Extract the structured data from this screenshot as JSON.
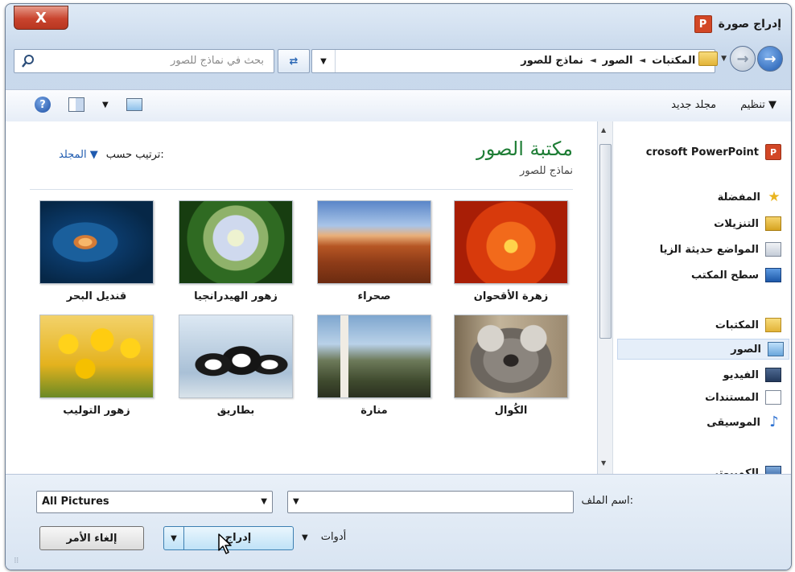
{
  "window": {
    "title": "إدراج صورة",
    "close_label": "X"
  },
  "address": {
    "crumbs": [
      "المكتبات",
      "الصور",
      "نماذج للصور"
    ],
    "search_placeholder": "بحث في نماذج للصور"
  },
  "toolbar": {
    "organize": "تنظيم ▼",
    "new_folder": "مجلد جديد",
    "help_icon_glyph": "?"
  },
  "sidebar": {
    "top_item": "crosoft PowerPoint",
    "favorites": "المفضلة",
    "downloads": "التنزيلات",
    "recent": "المواضع حديثة الزيا",
    "desktop": "سطح المكتب",
    "libraries": "المكتبات",
    "pictures": "الصور",
    "videos": "الفيديو",
    "documents": "المستندات",
    "music": "الموسيقى",
    "computer": "الكمبيوتر"
  },
  "content": {
    "title": "مكتبة الصور",
    "subtitle": "نماذج للصور",
    "arrange_label": "ترتيب حسب:",
    "arrange_value": "المجلد ▼",
    "images": [
      {
        "name": "زهرة الأقحوان"
      },
      {
        "name": "صحراء"
      },
      {
        "name": "زهور الهيدرانجيا"
      },
      {
        "name": "قنديل البحر"
      },
      {
        "name": "الكُوال"
      },
      {
        "name": "منارة"
      },
      {
        "name": "بطاريق"
      },
      {
        "name": "زهور التوليب"
      }
    ]
  },
  "bottom": {
    "filename_label": "اسم الملف:",
    "filetype_value": "All Pictures",
    "tools_label": "أدوات",
    "insert_label": "إدراج",
    "cancel_label": "إلغاء الأمر"
  }
}
